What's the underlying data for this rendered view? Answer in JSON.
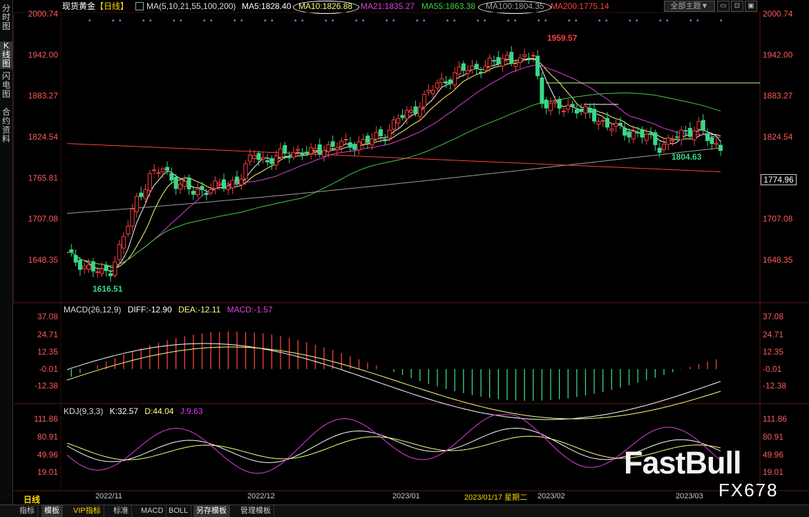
{
  "sidebar": {
    "tabs": [
      {
        "label": "分时图",
        "active": false
      },
      {
        "label": "K线图",
        "active": true
      },
      {
        "label": "闪电图",
        "active": false
      },
      {
        "label": "合约资料",
        "active": false
      }
    ]
  },
  "header": {
    "title": "现货黄金",
    "period": "【日线】",
    "ma_params": "MA(5,10,21,55,100,200)",
    "ma5": "MA5:1828.40",
    "ma10": "MA10:1826.88",
    "ma21": "MA21:1835.27",
    "ma55": "MA55:1863.38",
    "ma100": "MA100:1804.35",
    "ma200": "MA200:1775.14",
    "theme_button": "全部主题▼",
    "win_min": "▭",
    "win_max": "⊡",
    "win_close": "▣"
  },
  "price_axis": {
    "right_labels": [
      "2000.74",
      "1942.00",
      "1883.27",
      "1824.54",
      "1765.81",
      "1707.08",
      "1648.35"
    ],
    "left_labels": [
      "2000.74",
      "1942.00",
      "1883.27",
      "1824.54",
      "1765.81",
      "1707.08",
      "1648.35"
    ],
    "current_price": "1774.96",
    "annotations": {
      "high": "1959.57",
      "low": "1616.51",
      "recent_low": "1804.63"
    }
  },
  "macd": {
    "title": "MACD(26,12,9)",
    "diff": "DIFF:-12.90",
    "dea": "DEA:-12.11",
    "macd": "MACD:-1.57",
    "axis_labels": [
      "37.08",
      "24.71",
      "12.35",
      "-0.01",
      "-12.38"
    ]
  },
  "kdj": {
    "title": "KDJ(9,3,3)",
    "k": "K:32.57",
    "d": "D:44.04",
    "j": "J:9.63",
    "axis_labels": [
      "111.86",
      "80.91",
      "49.96",
      "19.01"
    ]
  },
  "time_axis": {
    "period_label": "日线",
    "dates": [
      "2022/11",
      "2022/12",
      "2023/01",
      "2023/02",
      "2023/03"
    ],
    "highlight": "2023/01/17 星期二"
  },
  "bottom_tabs": [
    {
      "label": "指标",
      "active": false
    },
    {
      "label": "模板",
      "active": true
    },
    {
      "label": "VIP指标",
      "active": false
    },
    {
      "label": "标准",
      "active": false
    },
    {
      "label": "MACD",
      "active": false
    },
    {
      "label": "BOLL",
      "active": false
    },
    {
      "label": "另存模板",
      "active": true
    },
    {
      "label": "管理模板",
      "active": false
    }
  ],
  "watermark": {
    "brand": "FastBull",
    "code": "FX678"
  },
  "colors": {
    "up": "#ff4040",
    "down": "#39d98a",
    "ma5": "#ffffff",
    "ma10": "#ffff80",
    "ma21": "#e040e0",
    "ma55": "#40d040",
    "ma100": "#a0a0a0",
    "ma200": "#ff4040"
  }
}
